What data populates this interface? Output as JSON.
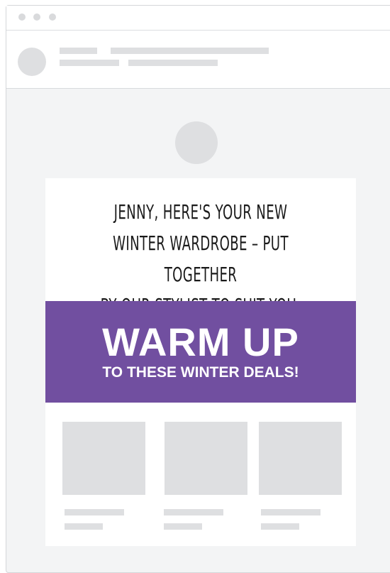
{
  "email": {
    "greeting_lines": [
      "JENNY, HERE'S YOUR NEW",
      "WINTER WARDROBE – PUT TOGETHER",
      "BY OUR STYLIST TO SUIT YOU."
    ],
    "banner": {
      "title": "WARM UP",
      "subtitle": "TO THESE WINTER DEALS!"
    }
  },
  "colors": {
    "banner_purple": "#714fa0",
    "placeholder_gray": "#dedfe1",
    "canvas_gray": "#f3f4f5"
  }
}
